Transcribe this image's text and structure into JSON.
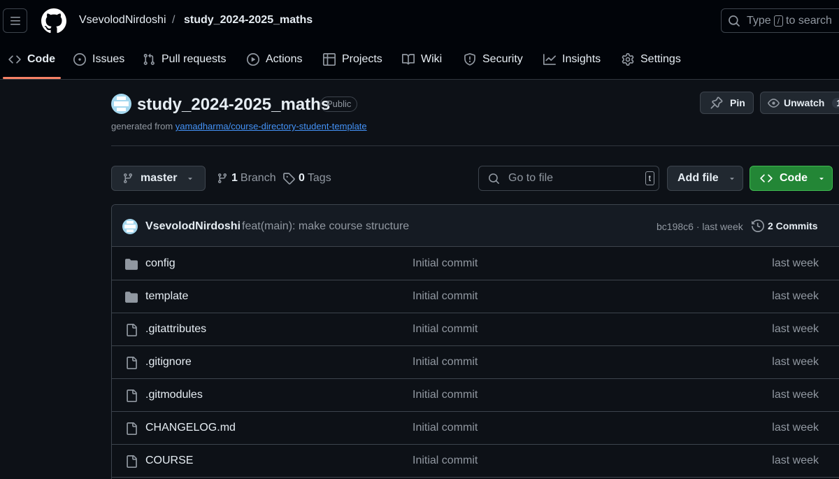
{
  "header": {
    "owner": "VsevolodNirdoshi",
    "separator": "/",
    "repo": "study_2024-2025_maths",
    "search": {
      "prefix": "Type",
      "key": "/",
      "suffix": "to search"
    }
  },
  "tabs": [
    {
      "label": "Code",
      "icon": "code-icon",
      "active": true
    },
    {
      "label": "Issues",
      "icon": "issue-opened-icon"
    },
    {
      "label": "Pull requests",
      "icon": "git-pull-request-icon"
    },
    {
      "label": "Actions",
      "icon": "play-icon"
    },
    {
      "label": "Projects",
      "icon": "table-icon"
    },
    {
      "label": "Wiki",
      "icon": "book-icon"
    },
    {
      "label": "Security",
      "icon": "shield-icon"
    },
    {
      "label": "Insights",
      "icon": "graph-icon"
    },
    {
      "label": "Settings",
      "icon": "gear-icon"
    }
  ],
  "repo": {
    "name": "study_2024-2025_maths",
    "visibility": "Public",
    "generated_prefix": "generated from",
    "template_link": "yamadharma/course-directory-student-template",
    "pin_label": "Pin",
    "unwatch_label": "Unwatch",
    "watch_count": "1"
  },
  "toolbar": {
    "branch": "master",
    "branch_count": "1",
    "branch_label": "Branch",
    "tag_count": "0",
    "tag_label": "Tags",
    "goto_placeholder": "Go to file",
    "goto_key": "t",
    "add_file": "Add file",
    "code": "Code"
  },
  "latest_commit": {
    "author": "VsevolodNirdoshi",
    "message": "feat(main): make course structure",
    "meta": "bc198c6 · last week",
    "commits": "2 Commits"
  },
  "files": [
    {
      "type": "dir",
      "name": "config",
      "message": "Initial commit",
      "date": "last week"
    },
    {
      "type": "dir",
      "name": "template",
      "message": "Initial commit",
      "date": "last week"
    },
    {
      "type": "file",
      "name": ".gitattributes",
      "message": "Initial commit",
      "date": "last week"
    },
    {
      "type": "file",
      "name": ".gitignore",
      "message": "Initial commit",
      "date": "last week"
    },
    {
      "type": "file",
      "name": ".gitmodules",
      "message": "Initial commit",
      "date": "last week"
    },
    {
      "type": "file",
      "name": "CHANGELOG.md",
      "message": "Initial commit",
      "date": "last week"
    },
    {
      "type": "file",
      "name": "COURSE",
      "message": "Initial commit",
      "date": "last week"
    }
  ],
  "colors": {
    "background": "#0d1117",
    "header_bg": "#010409",
    "accent_underline": "#f78166",
    "link": "#4493f8",
    "code_button": "#238636"
  }
}
